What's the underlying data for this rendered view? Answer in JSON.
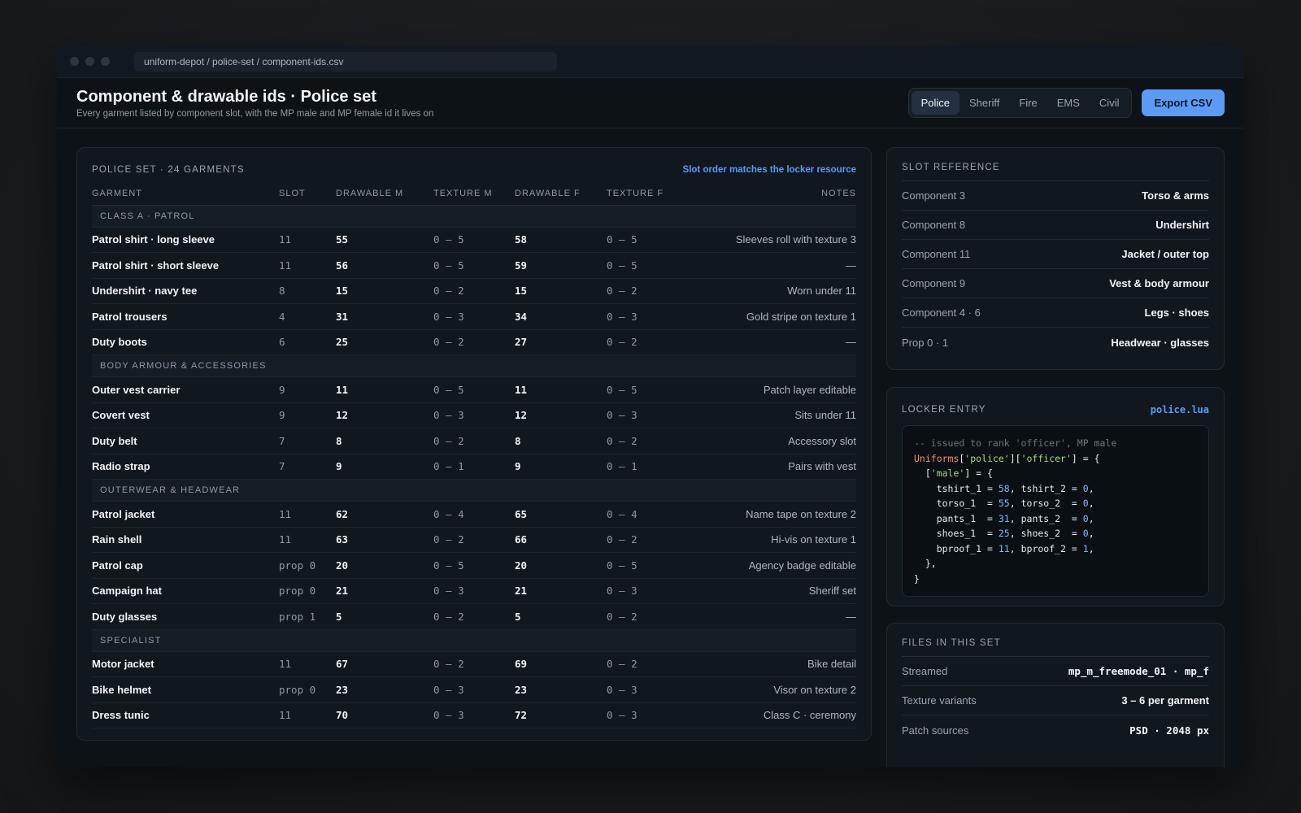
{
  "window": {
    "path": "uniform-depot / police-set / component-ids.csv"
  },
  "header": {
    "title": "Component & drawable ids · Police set",
    "subtitle": "Every garment listed by component slot, with the MP male and MP female id it lives on",
    "tabs": [
      "Police",
      "Sheriff",
      "Fire",
      "EMS",
      "Civil"
    ],
    "active_tab": "Police",
    "export_label": "Export CSV"
  },
  "table": {
    "heading": "POLICE SET · 24 GARMENTS",
    "note_link": "Slot order matches the locker resource",
    "columns": [
      "GARMENT",
      "SLOT",
      "DRAWABLE M",
      "TEXTURE M",
      "DRAWABLE F",
      "TEXTURE F",
      "NOTES"
    ],
    "groups": [
      {
        "label": "CLASS A · PATROL",
        "rows": [
          [
            "Patrol shirt · long sleeve",
            "11",
            "55",
            "0 – 5",
            "58",
            "0 – 5",
            "Sleeves roll with texture 3"
          ],
          [
            "Patrol shirt · short sleeve",
            "11",
            "56",
            "0 – 5",
            "59",
            "0 – 5",
            "—"
          ],
          [
            "Undershirt · navy tee",
            "8",
            "15",
            "0 – 2",
            "15",
            "0 – 2",
            "Worn under 11"
          ],
          [
            "Patrol trousers",
            "4",
            "31",
            "0 – 3",
            "34",
            "0 – 3",
            "Gold stripe on texture 1"
          ],
          [
            "Duty boots",
            "6",
            "25",
            "0 – 2",
            "27",
            "0 – 2",
            "—"
          ]
        ]
      },
      {
        "label": "BODY ARMOUR & ACCESSORIES",
        "rows": [
          [
            "Outer vest carrier",
            "9",
            "11",
            "0 – 5",
            "11",
            "0 – 5",
            "Patch layer editable"
          ],
          [
            "Covert vest",
            "9",
            "12",
            "0 – 3",
            "12",
            "0 – 3",
            "Sits under 11"
          ],
          [
            "Duty belt",
            "7",
            "8",
            "0 – 2",
            "8",
            "0 – 2",
            "Accessory slot"
          ],
          [
            "Radio strap",
            "7",
            "9",
            "0 – 1",
            "9",
            "0 – 1",
            "Pairs with vest"
          ]
        ]
      },
      {
        "label": "OUTERWEAR & HEADWEAR",
        "rows": [
          [
            "Patrol jacket",
            "11",
            "62",
            "0 – 4",
            "65",
            "0 – 4",
            "Name tape on texture 2"
          ],
          [
            "Rain shell",
            "11",
            "63",
            "0 – 2",
            "66",
            "0 – 2",
            "Hi-vis on texture 1"
          ],
          [
            "Patrol cap",
            "prop 0",
            "20",
            "0 – 5",
            "20",
            "0 – 5",
            "Agency badge editable"
          ],
          [
            "Campaign hat",
            "prop 0",
            "21",
            "0 – 3",
            "21",
            "0 – 3",
            "Sheriff set"
          ],
          [
            "Duty glasses",
            "prop 1",
            "5",
            "0 – 2",
            "5",
            "0 – 2",
            "—"
          ]
        ]
      },
      {
        "label": "SPECIALIST",
        "rows": [
          [
            "Motor jacket",
            "11",
            "67",
            "0 – 2",
            "69",
            "0 – 2",
            "Bike detail"
          ],
          [
            "Bike helmet",
            "prop 0",
            "23",
            "0 – 3",
            "23",
            "0 – 3",
            "Visor on texture 2"
          ],
          [
            "Dress tunic",
            "11",
            "70",
            "0 – 3",
            "72",
            "0 – 3",
            "Class C · ceremony"
          ]
        ]
      }
    ]
  },
  "slot_reference": {
    "title": "SLOT REFERENCE",
    "items": [
      {
        "k": "Component 3",
        "v": "Torso & arms"
      },
      {
        "k": "Component 8",
        "v": "Undershirt"
      },
      {
        "k": "Component 11",
        "v": "Jacket / outer top"
      },
      {
        "k": "Component 9",
        "v": "Vest & body armour"
      },
      {
        "k": "Component 4 · 6",
        "v": "Legs · shoes"
      },
      {
        "k": "Prop 0 · 1",
        "v": "Headwear · glasses"
      }
    ]
  },
  "locker": {
    "title": "LOCKER ENTRY",
    "file": "police.lua",
    "code": {
      "comment": "-- issued to rank 'officer', MP male",
      "table_name": "Uniforms",
      "key1": "'police'",
      "key2": "'officer'",
      "male_key": "'male'",
      "fields": [
        {
          "a": "tshirt_1",
          "av": "58",
          "b": "tshirt_2",
          "bv": "0"
        },
        {
          "a": "torso_1",
          "av": "55",
          "b": "torso_2",
          "bv": "0"
        },
        {
          "a": "pants_1",
          "av": "31",
          "b": "pants_2",
          "bv": "0"
        },
        {
          "a": "shoes_1",
          "av": "25",
          "b": "shoes_2",
          "bv": "0"
        },
        {
          "a": "bproof_1",
          "av": "11",
          "b": "bproof_2",
          "bv": "1"
        }
      ]
    }
  },
  "files": {
    "title": "FILES IN THIS SET",
    "items": [
      {
        "k": "Streamed",
        "v": "mp_m_freemode_01 · mp_f"
      },
      {
        "k": "Texture variants",
        "v": "3 – 6 per garment"
      },
      {
        "k": "Patch sources",
        "v": "PSD · 2048 px"
      }
    ]
  }
}
